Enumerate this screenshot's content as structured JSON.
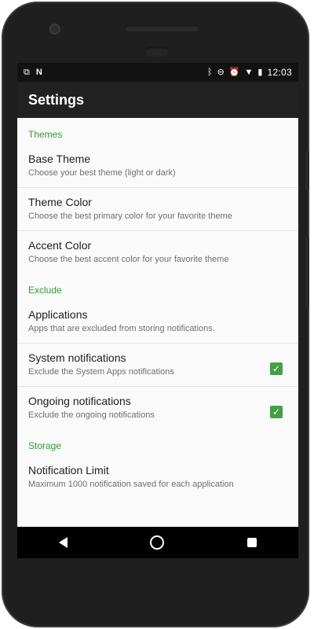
{
  "statusbar": {
    "time": "12:03",
    "icons_left": [
      "cast-icon",
      "notification-n-icon"
    ],
    "icons_right": [
      "bluetooth-icon",
      "do-not-disturb-icon",
      "alarm-icon",
      "wifi-icon",
      "battery-icon"
    ]
  },
  "appbar": {
    "title": "Settings"
  },
  "sections": [
    {
      "header": "Themes",
      "items": [
        {
          "title": "Base Theme",
          "summary": "Choose your best theme (light or dark)"
        },
        {
          "title": "Theme Color",
          "summary": "Choose the best primary color for your favorite theme"
        },
        {
          "title": "Accent Color",
          "summary": "Choose the best accent color for your favorite theme"
        }
      ]
    },
    {
      "header": "Exclude",
      "items": [
        {
          "title": "Applications",
          "summary": "Apps that are excluded from storing notifications."
        },
        {
          "title": "System notifications",
          "summary": "Exclude the System Apps notifications",
          "checked": true
        },
        {
          "title": "Ongoing notifications",
          "summary": "Exclude the ongoing notifications",
          "checked": true
        }
      ]
    },
    {
      "header": "Storage",
      "items": [
        {
          "title": "Notification Limit",
          "summary": "Maximum 1000 notification saved for each application"
        }
      ]
    }
  ],
  "colors": {
    "accent": "#2e9b32",
    "checkbox": "#43a047",
    "appbar": "#212121"
  }
}
